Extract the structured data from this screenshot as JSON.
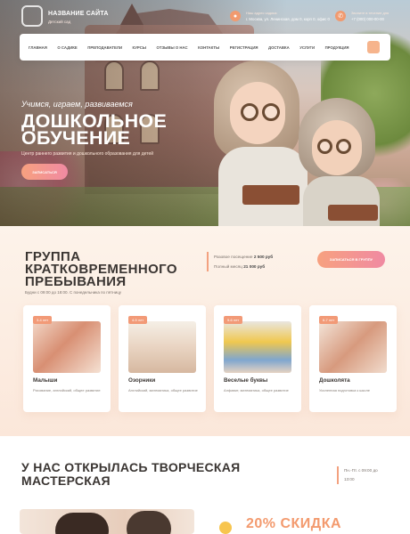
{
  "header": {
    "site_name": "НАЗВАНИЕ САЙТА",
    "site_sub": "Детский сад",
    "address_label": "Наш адрес садика:",
    "address": "г. Москва, ул. Ленинская, дом 0, корп 0, офис 0",
    "phone_label": "Звоните в течение дня",
    "phone": "+7 (000) 000-00-00"
  },
  "nav": {
    "items": [
      "ГЛАВНАЯ",
      "О САДИКЕ",
      "ПРЕПОДАВАТЕЛИ",
      "КУРСЫ",
      "ОТЗЫВЫ О НАС",
      "КОНТАКТЫ",
      "РЕГИСТРАЦИЯ",
      "ДОСТАВКА",
      "УСЛУГИ",
      "ПРОДУКЦИЯ"
    ]
  },
  "hero": {
    "tagline": "Учимся, играем, развиваемся",
    "title_line1": "ДОШКОЛЬНОЕ",
    "title_line2": "ОБУЧЕНИЕ",
    "description": "Центр раннего развития и дошкольного образования для детей",
    "button": "ЗАПИСАТЬСЯ"
  },
  "group": {
    "title_line1": "ГРУППА",
    "title_line2": "КРАТКОВРЕМЕННОГО",
    "title_line3": "ПРЕБЫВАНИЯ",
    "subtitle": "Будни с 09:00 до 18:00. С понедельника по пятницу",
    "price_single_label": "Разовое посещение",
    "price_single": "2 500 руб",
    "price_month_label": "Полный месяц",
    "price_month": "21 000 руб",
    "button": "ЗАПИСАТЬСЯ В ГРУППУ",
    "cards": [
      {
        "age": "3-4 лет",
        "title": "Малыши",
        "desc": "Рисование, английский, общее развитие"
      },
      {
        "age": "4-5 лет",
        "title": "Озорники",
        "desc": "Английский, математика, общее развитие"
      },
      {
        "age": "5-6 лет",
        "title": "Веселые буквы",
        "desc": "Алфавит, математика, общее развитие"
      },
      {
        "age": "6-7 лет",
        "title": "Дошколята",
        "desc": "Усиленная подготовка к школе"
      }
    ]
  },
  "workshop": {
    "title_line1": "У НАС ОТКРЫЛАСЬ ТВОРЧЕСКАЯ",
    "title_line2": "МАСТЕРСКАЯ",
    "hours_line1": "Пн.-Пт. с 09:00 до",
    "hours_line2": "13:00",
    "discount": "20% СКИДКА"
  },
  "colors": {
    "accent": "#f39a6e",
    "accent_pink": "#f08aa2",
    "heading": "#3a3532"
  }
}
